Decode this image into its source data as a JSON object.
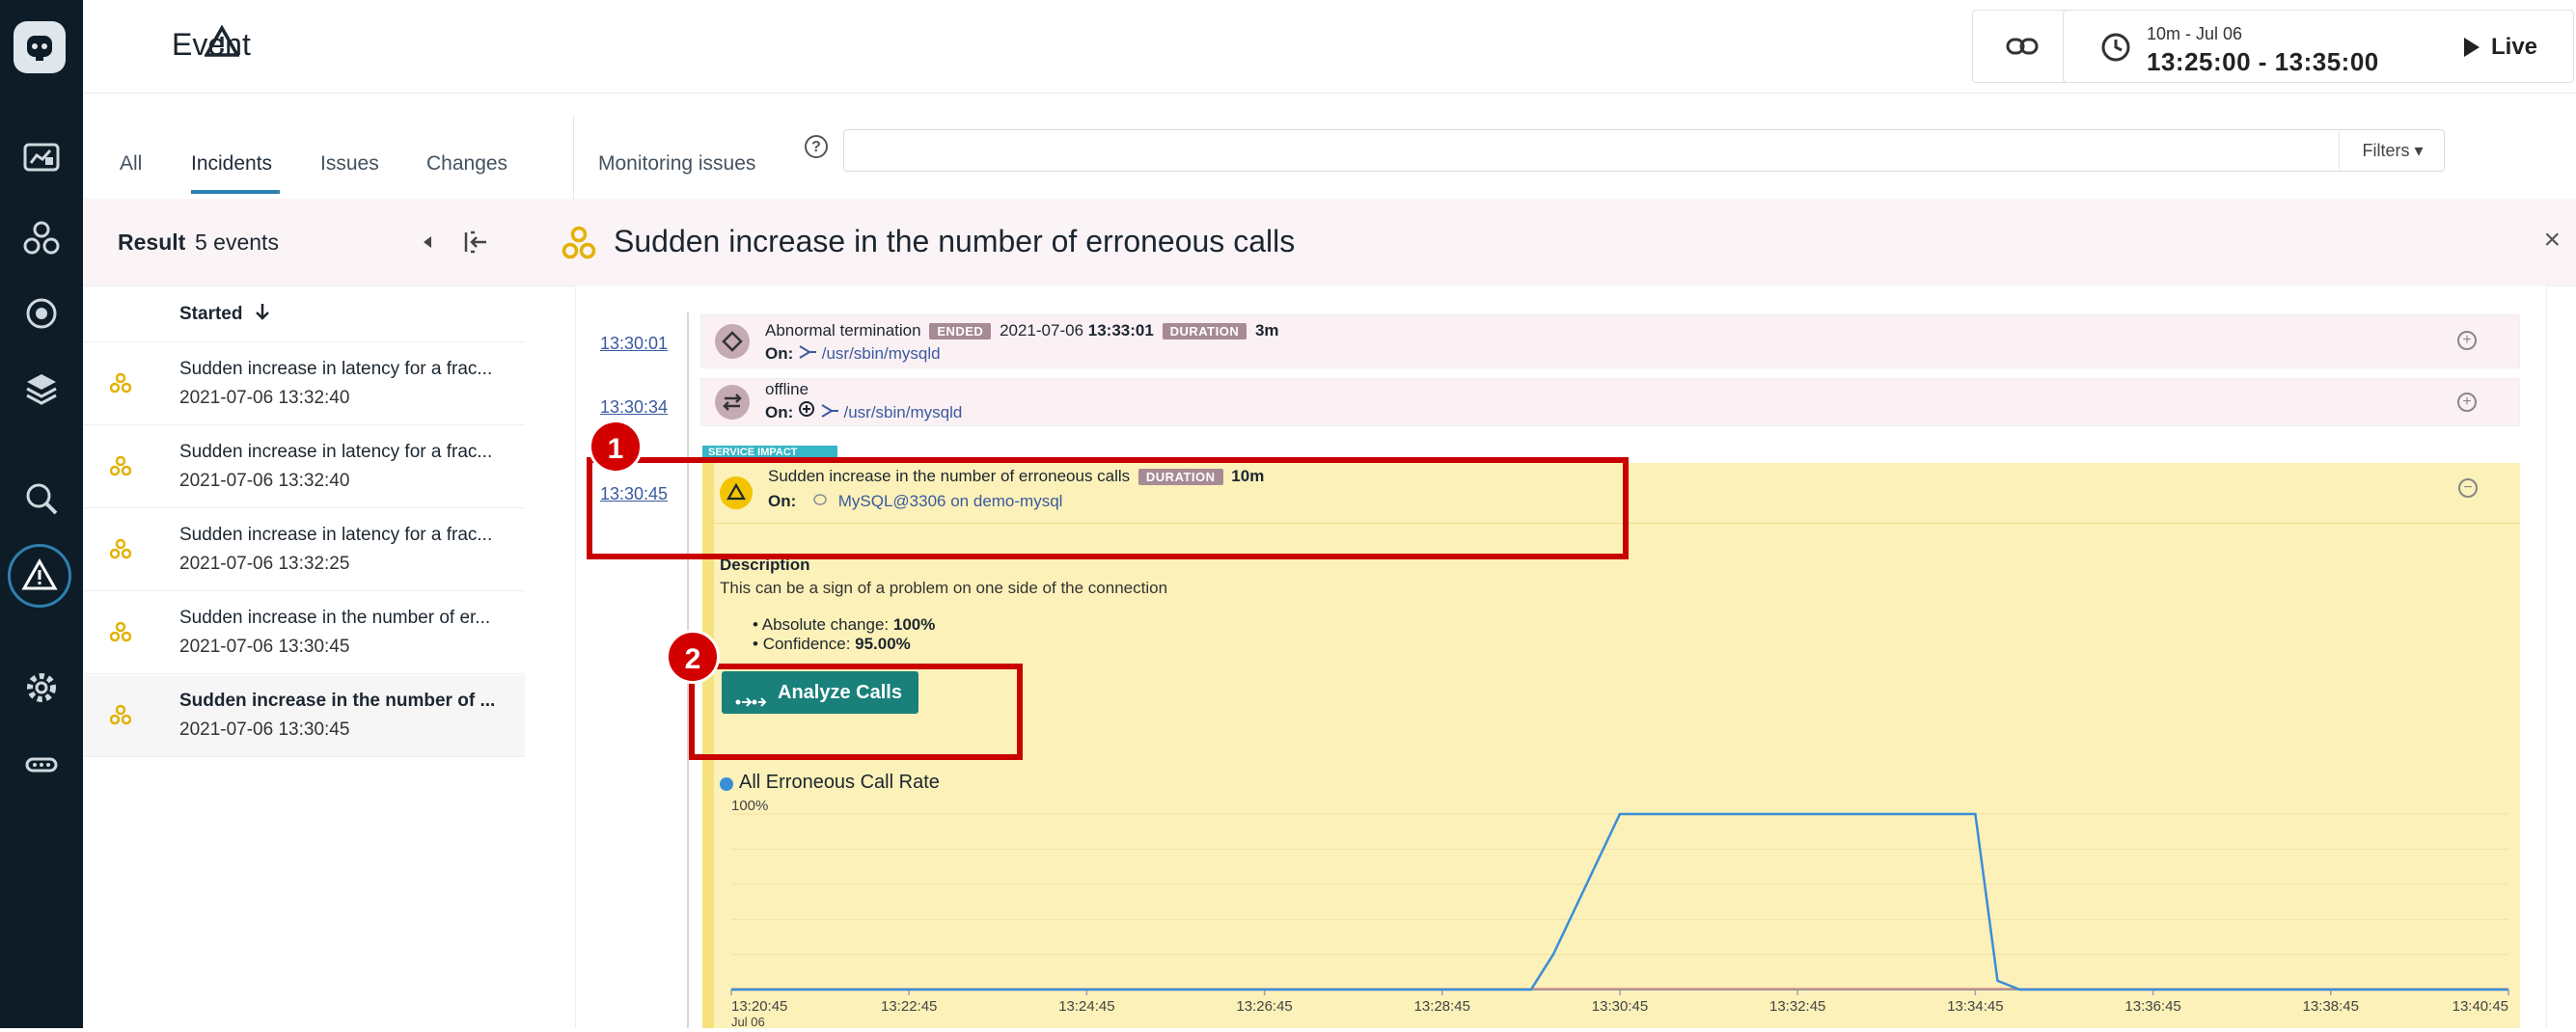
{
  "header": {
    "title": "Event",
    "time_range_small": "10m - Jul 06",
    "time_range_big": "13:25:00 - 13:35:00",
    "live_label": "Live"
  },
  "tabs": [
    "All",
    "Incidents",
    "Issues",
    "Changes"
  ],
  "monitoring_label": "Monitoring issues",
  "help_icon": "?",
  "filters_label": "Filters",
  "filter_caret": "▾",
  "result": {
    "label": "Result",
    "count": "5 events"
  },
  "list_sort_label": "Started",
  "events": [
    {
      "title": "Sudden increase in latency for a frac...",
      "time": "2021-07-06 13:32:40"
    },
    {
      "title": "Sudden increase in latency for a frac...",
      "time": "2021-07-06 13:32:40"
    },
    {
      "title": "Sudden increase in latency for a frac...",
      "time": "2021-07-06 13:32:25"
    },
    {
      "title": "Sudden increase in the number of er...",
      "time": "2021-07-06 13:30:45"
    },
    {
      "title": "Sudden increase in the number of ...",
      "time": "2021-07-06 13:30:45"
    }
  ],
  "detail": {
    "title": "Sudden increase in the number of erroneous calls",
    "close": "×",
    "entries": [
      {
        "time": "13:30:01",
        "title": "Abnormal termination",
        "badge1": "ENDED",
        "date": "2021-07-06",
        "date_time": "13:33:01",
        "badge2": "DURATION",
        "duration": "3m",
        "on_label": "On:",
        "on_value": "/usr/sbin/mysqld"
      },
      {
        "time": "13:30:34",
        "title": "offline",
        "on_label": "On:",
        "on_value": "/usr/sbin/mysqld"
      },
      {
        "time": "13:30:45",
        "impact_tag": "SERVICE IMPACT",
        "title": "Sudden increase in the number of erroneous calls",
        "badge": "DURATION",
        "duration": "10m",
        "on_label": "On:",
        "on_value": "MySQL@3306 on demo-mysql"
      }
    ],
    "description_heading": "Description",
    "description_text": "This can be a sign of a problem on one side of the connection",
    "bullets": [
      {
        "label": "Absolute change: ",
        "value": "100%"
      },
      {
        "label": "Confidence: ",
        "value": "95.00%"
      }
    ],
    "analyze_label": "Analyze Calls"
  },
  "annotations": [
    "1",
    "2"
  ],
  "chart_data": {
    "type": "line",
    "title": "All Erroneous Call Rate",
    "series": [
      {
        "name": "All Erroneous Call Rate",
        "color": "#3a8ed8",
        "x": [
          "13:20:45",
          "13:29:30",
          "13:29:45",
          "13:30:00",
          "13:30:45",
          "13:34:45",
          "13:35:00",
          "13:35:15",
          "13:40:45"
        ],
        "values": [
          0,
          0,
          0,
          0.2,
          1.0,
          1.0,
          0.05,
          0,
          0
        ]
      }
    ],
    "x_ticks": [
      "13:20:45",
      "13:22:45",
      "13:24:45",
      "13:26:45",
      "13:28:45",
      "13:30:45",
      "13:32:45",
      "13:34:45",
      "13:36:45",
      "13:38:45",
      "13:40:45"
    ],
    "x_sub_label": "Jul 06",
    "y_top_label": "100%",
    "ylim": [
      0,
      1
    ],
    "grid": true
  }
}
